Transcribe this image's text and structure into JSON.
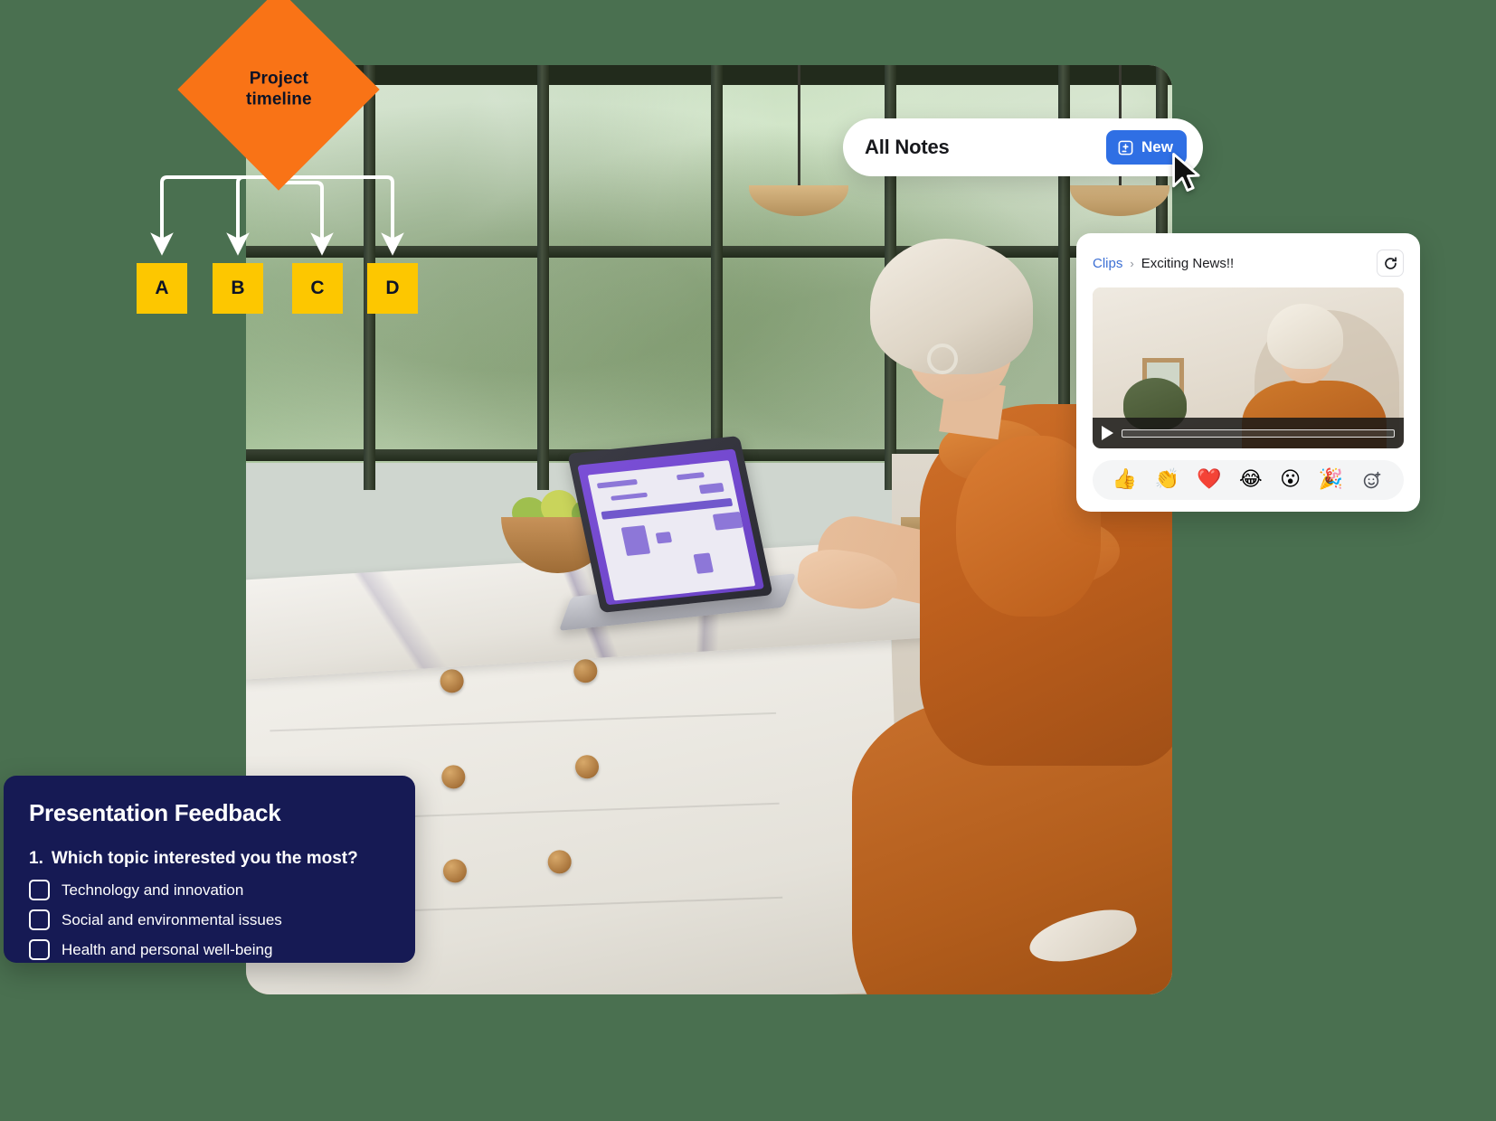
{
  "background_color": "#4a7050",
  "flowchart": {
    "root": {
      "label": "Project\ntimeline",
      "label_line1": "Project",
      "label_line2": "timeline",
      "color": "#f97316",
      "text_color": "#0d1326"
    },
    "nodes": [
      {
        "label": "A",
        "color": "#fdc700"
      },
      {
        "label": "B",
        "color": "#fdc700"
      },
      {
        "label": "C",
        "color": "#fdc700"
      },
      {
        "label": "D",
        "color": "#fdc700"
      }
    ],
    "connector_color": "#ffffff"
  },
  "notes_bar": {
    "title": "All Notes",
    "new_button": {
      "label": "New",
      "icon": "note-plus-icon",
      "color": "#2f6fe4"
    },
    "cursor": "mouse-pointer-icon"
  },
  "clips_card": {
    "breadcrumb": {
      "root": "Clips",
      "separator": "›",
      "leaf": "Exciting News!!",
      "root_color": "#3c6fd4"
    },
    "refresh_icon": "refresh-icon",
    "video": {
      "play_icon": "play-icon",
      "progress_percent": 0
    },
    "reactions": [
      {
        "name": "thumbs-up",
        "glyph": "👍"
      },
      {
        "name": "clapping-hands",
        "glyph": "👏"
      },
      {
        "name": "red-heart",
        "glyph": "❤️"
      },
      {
        "name": "face-with-tears-of-joy",
        "glyph": "😂"
      },
      {
        "name": "face-with-open-mouth",
        "glyph": "😮"
      },
      {
        "name": "party-popper",
        "glyph": "🎉"
      }
    ],
    "add_reaction": {
      "name": "add-reaction-icon",
      "glyph": "☺"
    }
  },
  "feedback_card": {
    "title": "Presentation Feedback",
    "question_number": "1.",
    "question": "Which topic interested you the most?",
    "background_color": "#161a54",
    "options": [
      {
        "label": "Technology and innovation",
        "checked": false
      },
      {
        "label": "Social and environmental issues",
        "checked": false
      },
      {
        "label": "Health and personal well-being",
        "checked": false
      }
    ]
  }
}
